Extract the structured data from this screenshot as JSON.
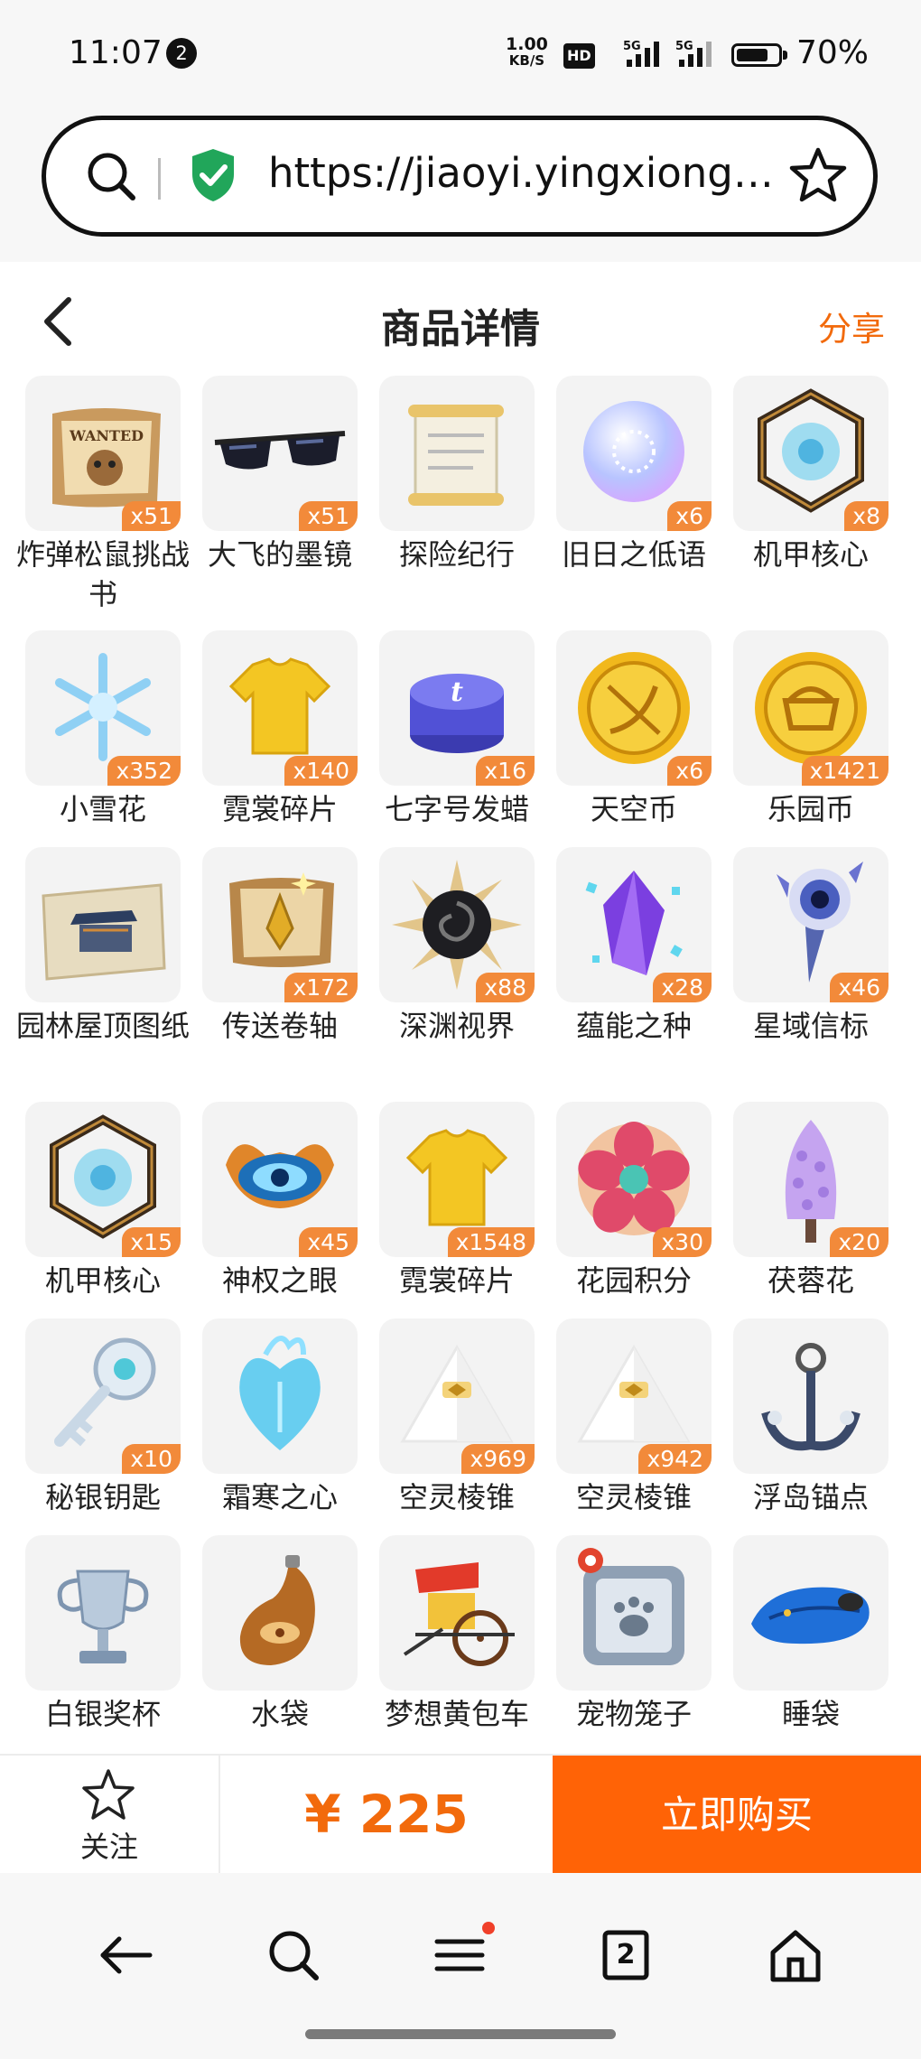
{
  "status_bar": {
    "time": "11:07",
    "notification_count": "2",
    "net_speed_value": "1.00",
    "net_speed_unit": "KB/S",
    "hd_label": "HD",
    "sim1": "5G",
    "sim2": "5G",
    "battery_pct": "70%"
  },
  "url_bar": {
    "url": "https://jiaoyi.yingxiong.c..."
  },
  "header": {
    "title": "商品详情",
    "share_label": "分享"
  },
  "items": [
    {
      "name": "炸弹松鼠挑战书",
      "qty": "x51",
      "icon": "wanted-poster-icon"
    },
    {
      "name": "大飞的墨镜",
      "qty": "x51",
      "icon": "sunglasses-icon"
    },
    {
      "name": "探险纪行",
      "qty": "",
      "icon": "scroll-icon"
    },
    {
      "name": "旧日之低语",
      "qty": "x6",
      "icon": "crystal-orb-icon"
    },
    {
      "name": "机甲核心",
      "qty": "x8",
      "icon": "mech-core-icon"
    },
    {
      "name": "小雪花",
      "qty": "x352",
      "icon": "snowflake-icon"
    },
    {
      "name": "霓裳碎片",
      "qty": "x140",
      "icon": "shirt-icon"
    },
    {
      "name": "七字号发蜡",
      "qty": "x16",
      "icon": "hair-wax-icon"
    },
    {
      "name": "天空币",
      "qty": "x6",
      "icon": "sky-coin-icon"
    },
    {
      "name": "乐园币",
      "qty": "x1421",
      "icon": "park-coin-icon"
    },
    {
      "name": "园林屋顶图纸",
      "qty": "",
      "icon": "blueprint-icon"
    },
    {
      "name": "传送卷轴",
      "qty": "x172",
      "icon": "teleport-scroll-icon"
    },
    {
      "name": "深渊视界",
      "qty": "x88",
      "icon": "abyss-sun-icon"
    },
    {
      "name": "蕴能之种",
      "qty": "x28",
      "icon": "purple-crystal-icon"
    },
    {
      "name": "星域信标",
      "qty": "x46",
      "icon": "beacon-icon"
    },
    {
      "name": "机甲核心",
      "qty": "x15",
      "icon": "mech-core-icon"
    },
    {
      "name": "神权之眼",
      "qty": "x45",
      "icon": "divine-eye-icon"
    },
    {
      "name": "霓裳碎片",
      "qty": "x1548",
      "icon": "shirt-icon"
    },
    {
      "name": "花园积分",
      "qty": "x30",
      "icon": "flower-badge-icon"
    },
    {
      "name": "茯蓉花",
      "qty": "x20",
      "icon": "lavender-flower-icon"
    },
    {
      "name": "秘银钥匙",
      "qty": "x10",
      "icon": "silver-key-icon"
    },
    {
      "name": "霜寒之心",
      "qty": "",
      "icon": "frost-heart-icon"
    },
    {
      "name": "空灵棱锥",
      "qty": "x969",
      "icon": "white-pyramid-icon"
    },
    {
      "name": "空灵棱锥",
      "qty": "x942",
      "icon": "white-pyramid-icon"
    },
    {
      "name": "浮岛锚点",
      "qty": "",
      "icon": "anchor-icon"
    },
    {
      "name": "白银奖杯",
      "qty": "",
      "icon": "silver-trophy-icon"
    },
    {
      "name": "水袋",
      "qty": "",
      "icon": "water-bag-icon"
    },
    {
      "name": "梦想黄包车",
      "qty": "",
      "icon": "rickshaw-icon"
    },
    {
      "name": "宠物笼子",
      "qty": "",
      "icon": "pet-cage-icon"
    },
    {
      "name": "睡袋",
      "qty": "",
      "icon": "sleeping-bag-icon"
    }
  ],
  "action_bar": {
    "follow_label": "关注",
    "price": "¥ 225",
    "buy_label": "立即购买"
  },
  "nav_bar": {
    "tab_count": "2"
  },
  "colors": {
    "accent": "#ff6306",
    "price": "#f26a0c",
    "qty_badge": "#f28a3a"
  }
}
